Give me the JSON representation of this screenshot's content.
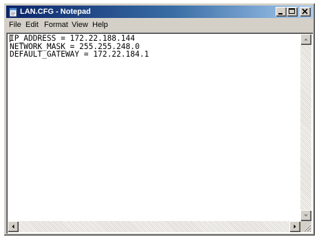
{
  "window": {
    "title": "LAN.CFG - Notepad",
    "icon": "notepad-icon",
    "buttons": [
      "minimize-icon",
      "maximize-icon",
      "close-icon"
    ]
  },
  "menu": {
    "items": [
      {
        "label": "File"
      },
      {
        "label": "Edit"
      },
      {
        "label": "Format"
      },
      {
        "label": "View"
      },
      {
        "label": "Help"
      }
    ]
  },
  "editor": {
    "lines": [
      "IP_ADDRESS = 172.22.188.144",
      "NETWORK_MASK = 255.255.248.0",
      "DEFAULT_GATEWAY = 172.22.184.1"
    ]
  },
  "colors": {
    "titlebar_start": "#0a246a",
    "titlebar_end": "#a6caf0",
    "face": "#d4d0c8",
    "editor_bg": "#ffffff"
  }
}
